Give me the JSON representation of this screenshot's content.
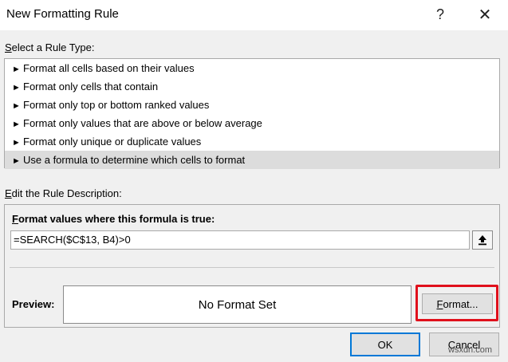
{
  "window": {
    "title": "New Formatting Rule",
    "help_glyph": "?",
    "close_glyph": "✕"
  },
  "rule_type": {
    "label_accel": "S",
    "label_rest": "elect a Rule Type:",
    "items": [
      {
        "label": "Format all cells based on their values",
        "selected": false
      },
      {
        "label": "Format only cells that contain",
        "selected": false
      },
      {
        "label": "Format only top or bottom ranked values",
        "selected": false
      },
      {
        "label": "Format only values that are above or below average",
        "selected": false
      },
      {
        "label": "Format only unique or duplicate values",
        "selected": false
      },
      {
        "label": "Use a formula to determine which cells to format",
        "selected": true
      }
    ],
    "arrow_glyph": "►"
  },
  "description": {
    "label_accel": "E",
    "label_rest": "dit the Rule Description:",
    "formula_heading_accel": "F",
    "formula_heading_rest": "ormat values where this formula is true:",
    "formula_value": "=SEARCH($C$13, B4)>0",
    "preview_label": "Preview:",
    "preview_text": "No Format Set",
    "format_button_accel": "F",
    "format_button_rest": "ormat..."
  },
  "buttons": {
    "ok": "OK",
    "cancel": "Cancel"
  },
  "watermark": "wsxdn.com",
  "colors": {
    "highlight": "#e0101c",
    "default_button_border": "#0078d7",
    "selected_row": "#dcdcdc"
  }
}
